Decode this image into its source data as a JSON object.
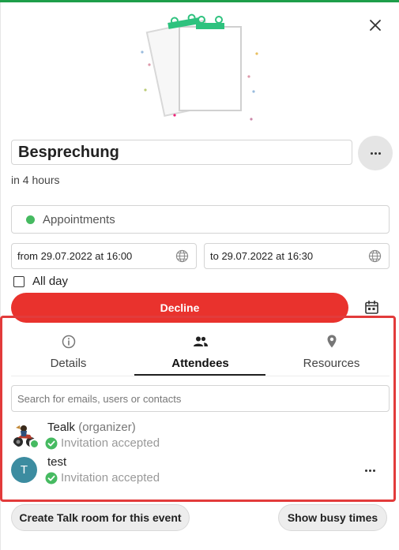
{
  "event": {
    "title": "Besprechung",
    "relative_time": "in 4 hours",
    "calendar": {
      "name": "Appointments",
      "color": "#46ba61"
    },
    "from": "from 29.07.2022 at 16:00",
    "to": "to 29.07.2022 at 16:30",
    "all_day_label": "All day",
    "all_day_checked": false
  },
  "actions": {
    "decline_label": "Decline",
    "decline_color": "#e9322d",
    "create_talk_label": "Create Talk room for this event",
    "show_busy_label": "Show busy times"
  },
  "tabs": [
    {
      "label": "Details",
      "icon": "info-icon",
      "active": false
    },
    {
      "label": "Attendees",
      "icon": "people-icon",
      "active": true
    },
    {
      "label": "Resources",
      "icon": "location-pin-icon",
      "active": false
    }
  ],
  "attendees": {
    "search_placeholder": "Search for emails, users or contacts",
    "list": [
      {
        "name": "Tealk",
        "role": "(organizer)",
        "status": "Invitation accepted",
        "avatar": "photo",
        "online": true
      },
      {
        "name": "test",
        "role": "",
        "status": "Invitation accepted",
        "avatar_letter": "T",
        "avatar_color": "#3c8ca0"
      }
    ]
  },
  "colors": {
    "accent": "#1e9e4a",
    "highlight_border": "#e23b3b",
    "accepted": "#46ba61"
  }
}
